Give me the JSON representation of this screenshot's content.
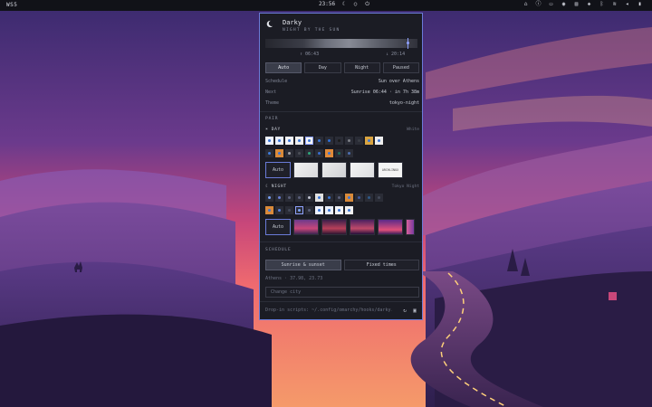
{
  "topbar": {
    "workspace": "WS5",
    "clock": "23:56",
    "center_icons": [
      "moon-icon",
      "circle-icon",
      "power-circle-icon"
    ],
    "right_icons": [
      "bell-icon",
      "info-circle-icon",
      "display-icon",
      "notification-icon",
      "folder-icon",
      "dropbox-icon",
      "bluetooth-icon",
      "wifi-icon",
      "volume-icon",
      "battery-icon"
    ]
  },
  "app": {
    "title": "Darky",
    "subtitle": "NIGHT BY THE SUN"
  },
  "timeline": {
    "sunrise": "06:43",
    "sunset": "20:14",
    "now_fraction": 0.93
  },
  "modes": [
    {
      "label": "Auto",
      "active": true
    },
    {
      "label": "Day",
      "active": false
    },
    {
      "label": "Night",
      "active": false
    },
    {
      "label": "Paused",
      "active": false
    }
  ],
  "info": [
    {
      "key": "Schedule",
      "value": "Sun over Athens"
    },
    {
      "key": "Next",
      "value": "Sunrise 06:44 · in 7h 38m"
    },
    {
      "key": "Theme",
      "value": "tokyo-night"
    }
  ],
  "pair": {
    "section_label": "PAIR",
    "day": {
      "label": "DAY",
      "theme": "White",
      "colors": [
        "#eef2ff",
        "#e9eef8",
        "#f2f3f6",
        "#eeeeee",
        "#f4f4f4",
        "#3a76d8",
        "#2f6fd6",
        "#1a1a1a",
        "#7d7f86",
        "#3a3d45",
        "#d9a441",
        "#eeeeee"
      ],
      "selected_index": 4,
      "colors_row2": [
        "#3f7ede",
        "#d98a3a",
        "#a0a2a8",
        "#4a4d55",
        "#2fa57a",
        "#3a6fd0",
        "#e08a3a",
        "#1e6b5a",
        "#4d6fb0"
      ],
      "wallpaper_auto": "Auto",
      "wallpapers": [
        "wp-white-1",
        "wp-white-2",
        "wp-white-3",
        "wp-white-4"
      ],
      "wallpaper_text": "ARCHLINUX"
    },
    "night": {
      "label": "NIGHT",
      "theme": "Tokyo Night",
      "colors": [
        "#7aa2f7",
        "#6b7fd8",
        "#5a5f7a",
        "#5a5f7a",
        "#c0c3d0",
        "#e0e0e0",
        "#3a76d8",
        "#5a5f7a",
        "#d98a3a",
        "#3d59a1",
        "#2f5a8a",
        "#444a5a"
      ],
      "colors_row2": [
        "#d98a3a",
        "#5a7fd6",
        "#444a5a",
        "#7aa2f7",
        "#5a5f7a",
        "#eef2ff",
        "#e9eef8",
        "#f2f3f6",
        "#f0f0f0"
      ],
      "selected_index_row2": 3,
      "wallpaper_auto": "Auto",
      "wallpapers": [
        "wp-night-1",
        "wp-night-2",
        "wp-night-3",
        "wp-night-4",
        "wp-night-5"
      ]
    }
  },
  "schedule": {
    "section_label": "SCHEDULE",
    "options": [
      {
        "label": "Sunrise & sunset",
        "active": true
      },
      {
        "label": "Fixed times",
        "active": false
      }
    ],
    "location": "Athens · 37.98, 23.73",
    "city_placeholder": "Change city"
  },
  "footer": {
    "text": "Drop-in scripts: ~/.config/omarchy/hooks/darky.d",
    "icons": [
      "refresh-icon",
      "save-icon"
    ]
  },
  "colors": {
    "accent": "#8fa2ff",
    "panel_bg": "#1b1c24",
    "border": "#6a7bd8"
  }
}
